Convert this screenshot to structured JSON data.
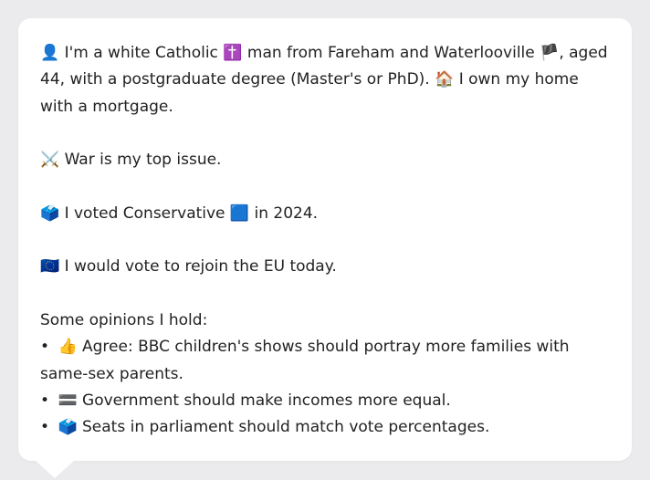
{
  "profile": {
    "intro_icon": "👤",
    "intro_a": "I'm a white Catholic",
    "religion_icon": "✝️",
    "intro_b": "man from Fareham and Waterlooville",
    "flag_icon": "🏴",
    "intro_c": ", aged 44, with a postgraduate degree (Master's or PhD).",
    "home_icon": "🏠",
    "intro_d": "I own my home with a mortgage."
  },
  "issue": {
    "icon": "⚔️",
    "text": "War is my top issue."
  },
  "vote": {
    "icon": "🗳️",
    "text_a": "I voted Conservative",
    "party_icon": "🟦",
    "text_b": "in 2024."
  },
  "eu": {
    "icon": "🇪🇺",
    "text": "I would vote to rejoin the EU today."
  },
  "opinions": {
    "heading": "Some opinions I hold:",
    "bullet_char": "•",
    "items": [
      {
        "icon": "👍",
        "text": "Agree: BBC children's shows should portray more families with same-sex parents."
      },
      {
        "icon": "🟰",
        "text": "Government should make incomes more equal."
      },
      {
        "icon": "🗳️",
        "text": "Seats in parliament should match vote percentages."
      }
    ]
  }
}
